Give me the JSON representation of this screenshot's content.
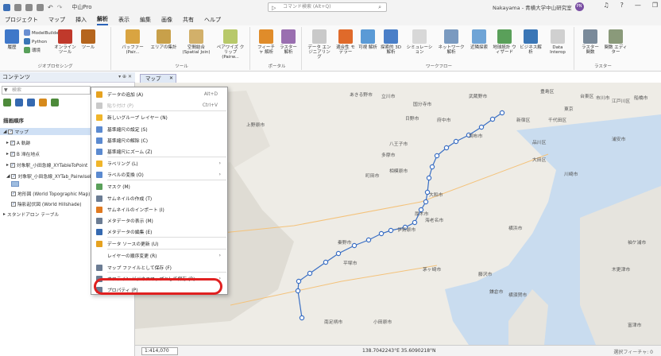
{
  "window": {
    "title": "中山Pro",
    "search_placeholder": "コマンド検索 (Alt+Q)",
    "user_label": "Nakayama - 青横大学中山研究室",
    "user_initials": "PN"
  },
  "menubar": {
    "items": [
      {
        "label": "プロジェクト"
      },
      {
        "label": "マップ"
      },
      {
        "label": "挿入"
      },
      {
        "label": "解析",
        "active": true
      },
      {
        "label": "表示"
      },
      {
        "label": "編集"
      },
      {
        "label": "画像"
      },
      {
        "label": "共有"
      },
      {
        "label": "ヘルプ"
      }
    ]
  },
  "ribbon": {
    "groups": [
      {
        "label": "ジオプロセシング",
        "buttons": [
          "履歴",
          "ModelBuilder",
          "Python",
          "環境",
          "オンライン ツール",
          "ツール"
        ]
      },
      {
        "label": "ツール",
        "buttons": [
          "バッファー (Pair...",
          "エリアの集計",
          "空間結合 (Spatial Join)",
          "ペアワイズ クリップ (Pairw..."
        ]
      },
      {
        "label": "ポータル",
        "buttons": [
          "フィーチャ 解析",
          "ラスター 解析"
        ]
      },
      {
        "label": "ワークフロー",
        "buttons": [
          "データ エンジニアリング",
          "適合性 モデラー",
          "可視 解析",
          "探索的 3D 解析",
          "シミュレーション",
          "ネットワーク解析",
          "近隣探索",
          "地球統計 ウィザード",
          "ビジネス解析",
          "Data Interop"
        ]
      },
      {
        "label": "ラスター",
        "buttons": [
          "ラスター 関数",
          "関数 エディター"
        ]
      }
    ]
  },
  "contents": {
    "title": "コンテンツ",
    "search_placeholder": "検索",
    "draw_order_label": "描画順序",
    "tree": [
      {
        "label": "マップ",
        "checked": true,
        "selected": true
      },
      {
        "label": "A 軌跡",
        "checked": true
      },
      {
        "label": "B 滞在地点",
        "checked": true
      },
      {
        "label": "対象駅_小田急線_XYTableToPoint",
        "checked": true
      },
      {
        "label": "対象駅_小田急線_XYTab_PairwiseBuf",
        "checked": true
      },
      {
        "label": "地形図 (World Topographic Map)",
        "checked": true
      },
      {
        "label": "陰影起伏図 (World Hillshade)",
        "checked": true
      },
      {
        "label": "スタンドアロン テーブル",
        "checked": false
      }
    ]
  },
  "map_tab": {
    "label": "マップ"
  },
  "context_menu": {
    "items": [
      {
        "label": "データの追加 (A)",
        "shortcut": "Alt+D",
        "icon_color": "#e6a21f"
      },
      {
        "label": "貼り付け (P)",
        "shortcut": "Ctrl+V",
        "disabled": true,
        "icon_color": "#c9c9c9"
      },
      {
        "label": "新しいグループ レイヤー (N)",
        "icon_color": "#f0b52a"
      },
      {
        "label": "基準縮尺の設定 (S)",
        "icon_color": "#5b8ad0"
      },
      {
        "label": "基準縮尺の解除 (C)",
        "icon_color": "#5b8ad0"
      },
      {
        "label": "基準縮尺にズーム (Z)",
        "icon_color": "#5b8ad0"
      },
      {
        "label": "ラベリング (L)",
        "submenu": true,
        "icon_color": "#f0b52a"
      },
      {
        "label": "ラベルの変換 (O)",
        "submenu": true,
        "icon_color": "#5b8ad0"
      },
      {
        "label": "マスク (M)",
        "icon_color": "#5aa05a"
      },
      {
        "label": "サムネイルの作成 (T)",
        "icon_color": "#6b7c93"
      },
      {
        "label": "サムネイルのインポート (I)",
        "icon_color": "#e07a20"
      },
      {
        "label": "メタデータの表示 (M)",
        "icon_color": "#6b7c93"
      },
      {
        "label": "メタデータの編集 (E)",
        "icon_color": "#3569b0"
      },
      {
        "label": "データ ソースの更新 (U)",
        "icon_color": "#e6a21f"
      },
      {
        "label": "レイヤーの順序変更 (R)",
        "submenu": true,
        "icon_color": "transparent"
      },
      {
        "label": "マップ ファイルとして保存 (F)",
        "icon_color": "#6b7c93"
      },
      {
        "label": "オフライン ビジネスマップとして保存 (B)",
        "submenu": true,
        "icon_color": "#6b7c93"
      },
      {
        "label": "プロパティ (P)",
        "icon_color": "#6b7c93",
        "highlighted": true
      }
    ]
  },
  "map": {
    "places": [
      "あきる野市",
      "立川市",
      "国分寺市",
      "武蔵野市",
      "豊島区",
      "台東区",
      "江戸川区",
      "日野市",
      "府中市",
      "調布市",
      "新宿区",
      "千代田区",
      "東京",
      "八王子市",
      "多摩市",
      "品川区",
      "浦安市",
      "上野原市",
      "町田市",
      "相模原市",
      "大田区",
      "川崎市",
      "大和市",
      "厚木市",
      "海老名市",
      "伊勢原市",
      "秦野市",
      "平塚市",
      "横浜市",
      "茅ヶ崎市",
      "藤沢市",
      "鎌倉市",
      "小田原市",
      "南足柄市",
      "横須賀市",
      "木更津市",
      "袖ケ浦市",
      "市川市",
      "船橋市",
      "富津市"
    ],
    "route_color": "#3a6fc4"
  },
  "statusbar": {
    "scale": "1:414,070",
    "coordinates": "138.7042243°E 35.6090218°N",
    "selected": "選択フィーチャ: 0"
  }
}
